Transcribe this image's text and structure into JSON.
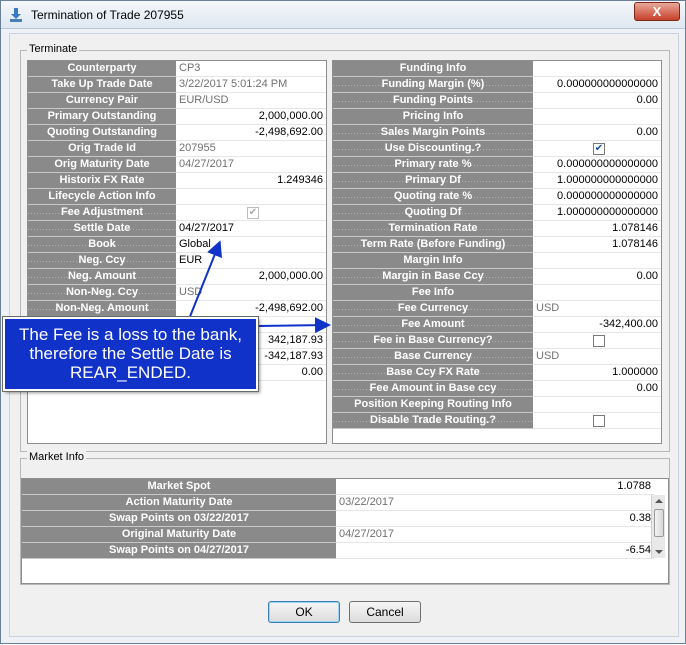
{
  "window": {
    "title": "Termination of Trade 207955",
    "close_label": "X"
  },
  "terminate": {
    "group_label": "Terminate",
    "left_rows": [
      {
        "label": "Counterparty",
        "value": "CP3"
      },
      {
        "label": "Take Up Trade Date",
        "value": "3/22/2017 5:01:24 PM"
      },
      {
        "label": "Currency Pair",
        "value": "EUR/USD"
      },
      {
        "label": "Primary Outstanding",
        "value": "2,000,000.00"
      },
      {
        "label": "Quoting Outstanding",
        "value": "-2,498,692.00"
      },
      {
        "label": "Orig Trade Id",
        "value": "207955"
      },
      {
        "label": "Orig Maturity Date",
        "value": "04/27/2017"
      },
      {
        "label": "Historix FX Rate",
        "value": "1.249346"
      },
      {
        "label": "Lifecycle Action Info",
        "value": ""
      },
      {
        "label": "Fee Adjustment",
        "value": "",
        "checkbox": true,
        "checked": true,
        "disabled": true
      },
      {
        "label": "Settle Date",
        "value": "04/27/2017"
      },
      {
        "label": "Book",
        "value": "Global"
      },
      {
        "label": "Neg. Ccy",
        "value": "EUR"
      },
      {
        "label": "Neg. Amount",
        "value": "2,000,000.00"
      },
      {
        "label": "Non-Neg. Ccy",
        "value": "USD"
      },
      {
        "label": "Non-Neg. Amount",
        "value": "-2,498,692.00"
      },
      {
        "label": "",
        "value": ""
      },
      {
        "label": "",
        "value": "342,187.93"
      },
      {
        "label": "",
        "value": "-342,187.93"
      },
      {
        "label": "",
        "value": "0.00"
      }
    ],
    "right_rows": [
      {
        "label": "Funding Info",
        "value": ""
      },
      {
        "label": "Funding Margin (%)",
        "value": "0.000000000000000"
      },
      {
        "label": "Funding Points",
        "value": "0.00"
      },
      {
        "label": "Pricing Info",
        "value": ""
      },
      {
        "label": "Sales Margin Points",
        "value": "0.00"
      },
      {
        "label": "Use Discounting.?",
        "value": "",
        "checkbox": true,
        "checked": true
      },
      {
        "label": "Primary rate %",
        "value": "0.000000000000000"
      },
      {
        "label": "Primary Df",
        "value": "1.000000000000000"
      },
      {
        "label": "Quoting rate %",
        "value": "0.000000000000000"
      },
      {
        "label": "Quoting Df",
        "value": "1.000000000000000"
      },
      {
        "label": "Termination Rate",
        "value": "1.078146"
      },
      {
        "label": "Term Rate (Before Funding)",
        "value": "1.078146"
      },
      {
        "label": "Margin Info",
        "value": ""
      },
      {
        "label": "Margin in Base Ccy",
        "value": "0.00"
      },
      {
        "label": "Fee Info",
        "value": ""
      },
      {
        "label": "Fee Currency",
        "value": "USD"
      },
      {
        "label": "Fee Amount",
        "value": "-342,400.00"
      },
      {
        "label": "Fee in Base Currency?",
        "value": "",
        "checkbox": true,
        "checked": false
      },
      {
        "label": "Base Currency",
        "value": "USD"
      },
      {
        "label": "Base Ccy FX Rate",
        "value": "1.000000"
      },
      {
        "label": "Fee Amount in Base ccy",
        "value": "0.00"
      },
      {
        "label": "Position Keeping Routing Info",
        "value": ""
      },
      {
        "label": "Disable Trade Routing.?",
        "value": "",
        "checkbox": true,
        "checked": false
      }
    ]
  },
  "market": {
    "group_label": "Market Info",
    "rows": [
      {
        "label": "Market Spot",
        "value": "1.0788"
      },
      {
        "label": "Action Maturity Date",
        "value": "03/22/2017"
      },
      {
        "label": "Swap Points on 03/22/2017",
        "value": "0.38"
      },
      {
        "label": "Original Maturity Date",
        "value": "04/27/2017"
      },
      {
        "label": "Swap Points on 04/27/2017",
        "value": "-6.54"
      }
    ]
  },
  "callout": {
    "text": "The Fee is a loss to the bank, therefore the Settle Date is REAR_ENDED."
  },
  "buttons": {
    "ok": "OK",
    "cancel": "Cancel"
  }
}
